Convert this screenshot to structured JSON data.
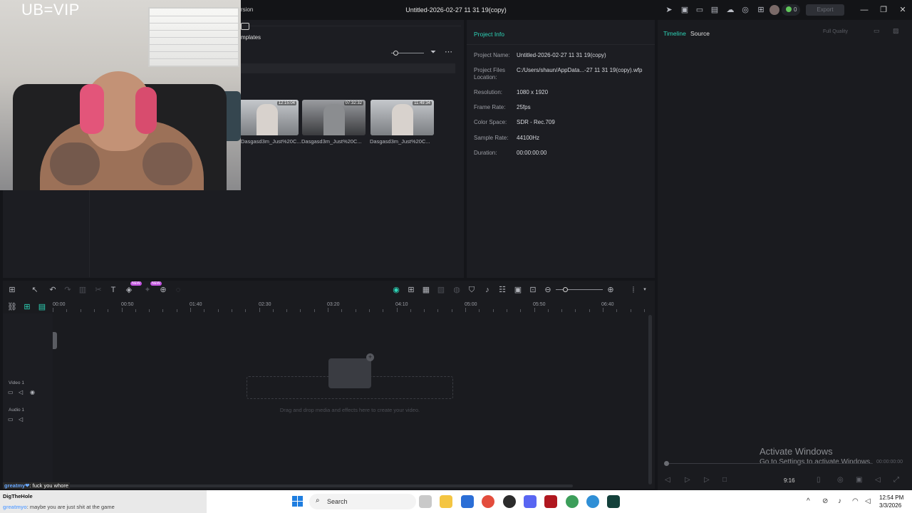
{
  "window": {
    "title": "Untitled-2026-02-27 11 31 19(copy)",
    "version_fragment": "rsion",
    "export_label": "Export",
    "gem_count": "0"
  },
  "overlay": {
    "stream_text": "UB=VIP"
  },
  "media": {
    "templates_tab": "mplates",
    "thumbnails": [
      {
        "duration": "12:15:04",
        "label": "Dasgasd3m_Just%20C..."
      },
      {
        "duration": "07:32:32",
        "label": "Dasgasd3m_Just%20C..."
      },
      {
        "duration": "11:49:34",
        "label": "Dasgasd3m_Just%20C..."
      }
    ]
  },
  "project_info": {
    "title": "Project Info",
    "rows": [
      {
        "key": "Project Name:",
        "value": "Untitled-2026-02-27 11 31 19(copy)"
      },
      {
        "key": "Project Files Location:",
        "value": "C:/Users/shaun/AppData...-27 11 31 19(copy).wfp"
      },
      {
        "key": "Resolution:",
        "value": "1080 x 1920"
      },
      {
        "key": "Frame Rate:",
        "value": "25fps"
      },
      {
        "key": "Color Space:",
        "value": "SDR - Rec.709"
      },
      {
        "key": "Sample Rate:",
        "value": "44100Hz"
      },
      {
        "key": "Duration:",
        "value": "00:00:00:00"
      }
    ]
  },
  "player": {
    "tab_timeline": "Timeline",
    "tab_source": "Source",
    "quality": "Full Quality",
    "time": "00:00:00:00",
    "ratio": "9:16"
  },
  "timeline": {
    "ruler_labels": [
      "00:00",
      "00:50",
      "01:40",
      "02:30",
      "03:20",
      "04:10",
      "05:00",
      "05:50",
      "06:40"
    ],
    "tracks": [
      {
        "name": "Video 1"
      },
      {
        "name": "Audio 1"
      }
    ],
    "drop_text": "Drag and drop media and effects here to create your video.",
    "new_badge": "NEW"
  },
  "watermark": {
    "title": "Activate Windows",
    "subtitle": "Go to Settings to activate Windows."
  },
  "chat": [
    {
      "user": "greatmy❤",
      "message": ": fuck you whore"
    },
    {
      "user": "DigTheHole",
      "message": ""
    },
    {
      "user": "greatmyo",
      "message": ": maybe you are just shit at the game"
    }
  ],
  "taskbar": {
    "search_placeholder": "Search",
    "time": "12:54 PM",
    "date": "3/3/2026"
  }
}
